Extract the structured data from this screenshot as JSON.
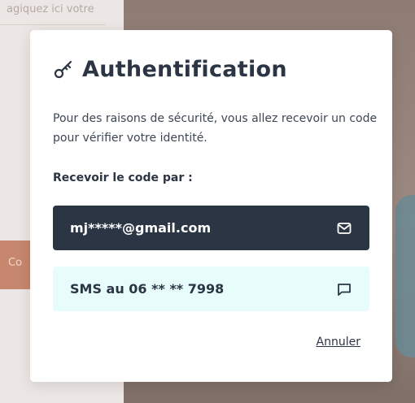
{
  "background": {
    "partial_text": "agiquez ici votre",
    "partial_button": "Co"
  },
  "modal": {
    "title": "Authentification",
    "title_icon": "key-icon",
    "description": "Pour des raisons de sécurité, vous allez recevoir un code pour vérifier votre identité.",
    "receive_label": "Recevoir le code par :",
    "options": [
      {
        "label": "mj*****@gmail.com",
        "icon": "mail-icon",
        "selected": true
      },
      {
        "label": "SMS au 06 ** ** 7998",
        "icon": "message-icon",
        "selected": false
      }
    ],
    "cancel_label": "Annuler"
  },
  "colors": {
    "primary": "#2b3544",
    "sms_bg": "#e6fdfb",
    "accent_bg": "#c7876f"
  }
}
